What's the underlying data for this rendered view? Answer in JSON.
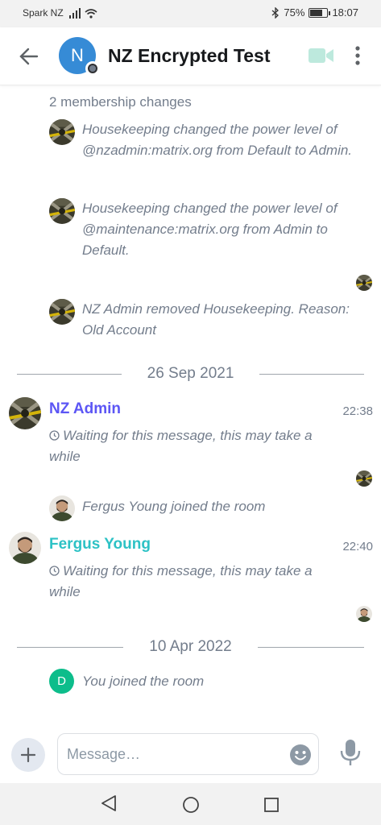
{
  "status_bar": {
    "carrier": "Spark NZ",
    "battery": "75%",
    "battery_level": 0.75,
    "time": "18:07"
  },
  "header": {
    "back_icon": "arrow-left-icon",
    "room_avatar_letter": "N",
    "room_name": "NZ Encrypted Test",
    "video_icon": "video-call-icon",
    "menu_icon": "more-vertical-icon",
    "accent": "#368bd6"
  },
  "timeline": {
    "membership_summary": "2 membership changes",
    "events": [
      {
        "text": "Housekeeping changed the power level of @nzadmin:matrix.org from Default to Admin."
      },
      {
        "text": "Housekeeping changed the power level of @maintenance:matrix.org from Admin to Default."
      },
      {
        "text": "NZ Admin removed Housekeeping. Reason: Old Account"
      }
    ],
    "date_1": "26 Sep 2021",
    "messages": [
      {
        "sender": "NZ Admin",
        "time": "22:38",
        "body": "Waiting for this message, this may take a while",
        "color": "#5c56f5"
      },
      {
        "sender": "Fergus Young",
        "time": "22:40",
        "body": "Waiting for this message, this may take a while",
        "color": "#2dc2c5"
      }
    ],
    "fergus_joined": "Fergus Young joined the room",
    "date_2": "10 Apr 2022",
    "you_avatar_letter": "D",
    "you_joined": "You joined the room"
  },
  "composer": {
    "placeholder": "Message…",
    "add_icon": "plus-icon",
    "emoji_icon": "emoji-icon",
    "mic_icon": "microphone-icon"
  },
  "nav_bar": {
    "back_icon": "triangle-back-icon",
    "home_icon": "circle-home-icon",
    "recents_icon": "square-recents-icon"
  }
}
